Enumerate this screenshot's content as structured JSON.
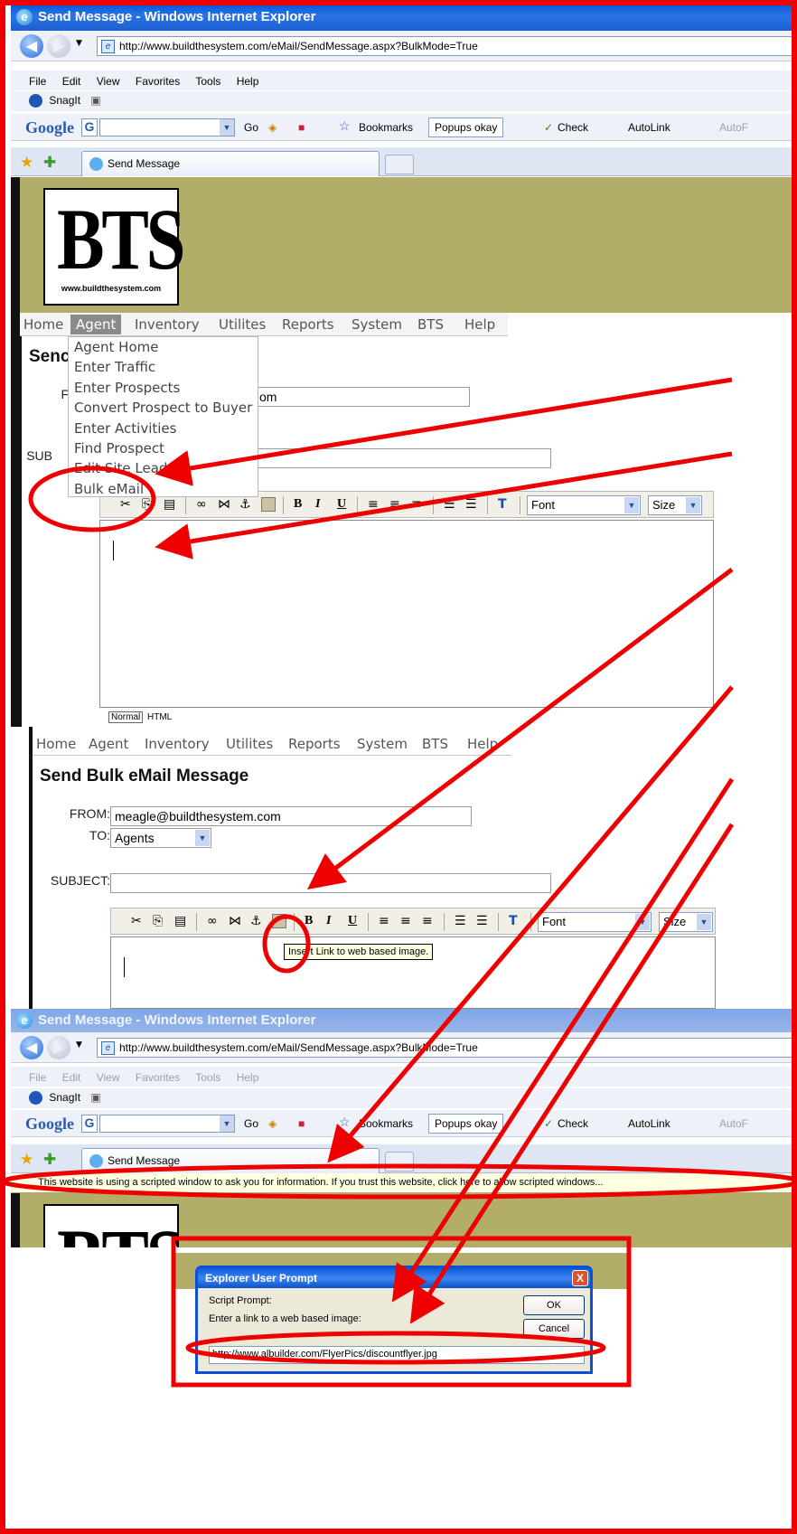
{
  "browser": {
    "title": "Send Message - Windows Internet Explorer",
    "url": "http://www.buildthesystem.com/eMail/SendMessage.aspx?BulkMode=True",
    "menu": [
      "File",
      "Edit",
      "View",
      "Favorites",
      "Tools",
      "Help"
    ],
    "snagit_label": "SnagIt",
    "google_label": "Google",
    "google_box_label": "G",
    "go_label": "Go",
    "bookmarks_label": "Bookmarks",
    "popups_label": "Popups okay",
    "check_label": "Check",
    "autolink_label": "AutoLink",
    "autofill_label": "AutoF",
    "tab_label": "Send Message",
    "infobar_text": "This website is using a scripted window to ask you for information. If you trust this website, click here to allow scripted windows..."
  },
  "site": {
    "logo_big": "BTS",
    "logo_small": "www.buildthesystem.com",
    "nav": [
      "Home",
      "Agent",
      "Inventory",
      "Utilites",
      "Reports",
      "System",
      "BTS",
      "Help"
    ],
    "agent_menu": [
      "Agent Home",
      "Enter Traffic",
      "Enter Prospects",
      "Convert Prospect to Buyer",
      "Enter Activities",
      "Find Prospect",
      "Edit Site Leads",
      "Bulk eMail"
    ],
    "partial_heading": "Senc",
    "partial_from_label": "FI",
    "partial_from_value": "om",
    "partial_subject_label": "SUB"
  },
  "form": {
    "heading": "Send Bulk eMail Message",
    "from_label": "FROM:",
    "from_value": "meagle@buildthesystem.com",
    "to_label": "TO:",
    "to_value": "Agents",
    "subject_label": "SUBJECT:",
    "subject_value": "",
    "font_label": "Font",
    "size_label": "Size",
    "bold": "B",
    "italic": "I",
    "underline": "U",
    "tooltip": "Insert Link to web based image.",
    "mode_normal": "Normal",
    "mode_html": "HTML"
  },
  "dialog": {
    "title": "Explorer User Prompt",
    "script_prompt": "Script Prompt:",
    "message": "Enter a link to a web based image:",
    "ok_label": "OK",
    "cancel_label": "Cancel",
    "input_value": "http://www.albuilder.com/FlyerPics/discountflyer.jpg",
    "close_label": "X"
  },
  "colors": {
    "annotation": "#ee0000",
    "banner": "#b3ad6a",
    "titlebar": "#0a5bd6"
  }
}
